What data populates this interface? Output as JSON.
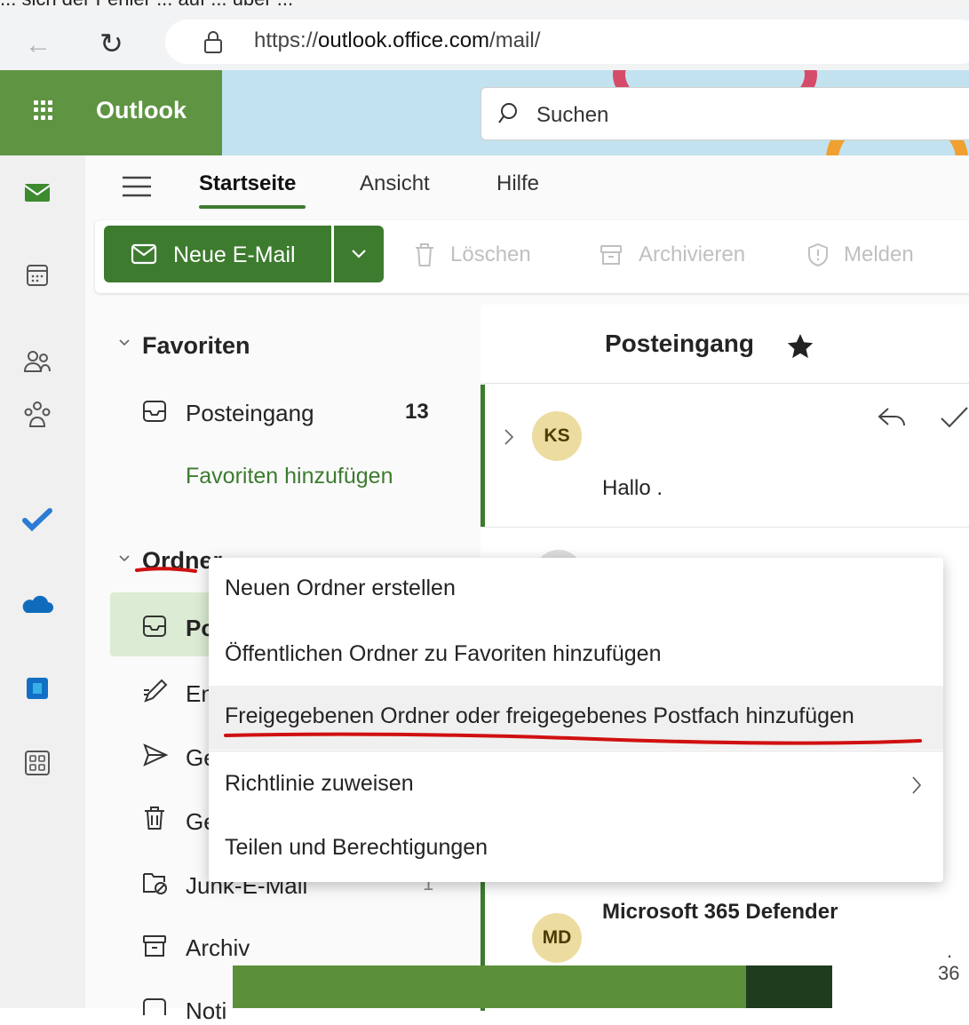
{
  "browser": {
    "top_fragment": "... sich der Fehler ... auf ... über ...",
    "url_prefix": "https://",
    "url_domain": "outlook.office.com",
    "url_path": "/mail/"
  },
  "header": {
    "app_name": "Outlook",
    "search_placeholder": "Suchen"
  },
  "tabs": [
    "Startseite",
    "Ansicht",
    "Hilfe"
  ],
  "toolbar": {
    "new_mail": "Neue E-Mail",
    "delete": "Löschen",
    "archive": "Archivieren",
    "report": "Melden"
  },
  "nav": {
    "favorites_header": "Favoriten",
    "favorites_inbox": "Posteingang",
    "favorites_inbox_count": "13",
    "add_favorites": "Favoriten hinzufügen",
    "folders_header": "Ordner",
    "folder_inbox": "Po",
    "folder_drafts": "En",
    "folder_sent": "Ge",
    "folder_deleted": "Ge",
    "folder_junk": "Junk-E-Mail",
    "folder_junk_count": "1",
    "folder_archive": "Archiv",
    "folder_notes": "Noti"
  },
  "list": {
    "title": "Posteingang",
    "mail1": {
      "initials": "KS",
      "preview": "Hallo ."
    },
    "mail2": {
      "initials": "MD",
      "sender": "Microsoft 365 Defender",
      "snippet": "36"
    }
  },
  "context_menu": [
    "Neuen Ordner erstellen",
    "Öffentlichen Ordner zu Favoriten hinzufügen",
    "Freigegebenen Ordner oder freigegebenes Postfach hinzufügen",
    "Richtlinie zuweisen",
    "Teilen und Berechtigungen"
  ],
  "colors": {
    "brand_green": "#3d7b2f",
    "header_green": "#5f9442",
    "annotation_red": "#d01010"
  }
}
